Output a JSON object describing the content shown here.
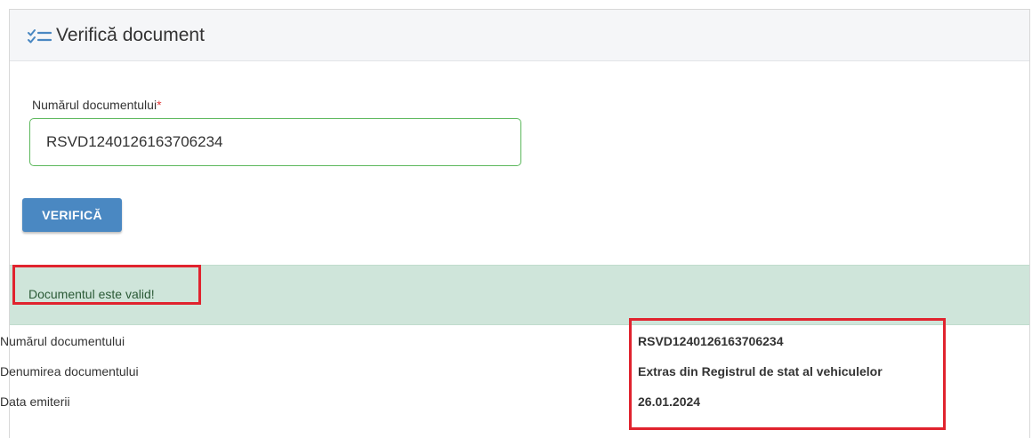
{
  "header": {
    "icon": "checklist-icon",
    "title": "Verifică document",
    "icon_color": "#4a88c2"
  },
  "form": {
    "label": "Numărul documentului",
    "required_mark": "*",
    "input_value": "RSVD1240126163706234",
    "submit_label": "VERIFICĂ"
  },
  "alert": {
    "message": "Documentul este valid!",
    "background": "#cfe5da",
    "text_color": "#2b5a36"
  },
  "details": {
    "rows": [
      {
        "label": "Numărul documentului",
        "value": "RSVD1240126163706234"
      },
      {
        "label": "Denumirea documentului",
        "value": "Extras din Registrul de stat al vehiculelor"
      },
      {
        "label": "Data emiterii",
        "value": "26.01.2024"
      }
    ]
  },
  "colors": {
    "accent": "#4a88c2",
    "input_border": "#5cb85c",
    "highlight": "#e0232e",
    "required": "#e03a3a"
  }
}
